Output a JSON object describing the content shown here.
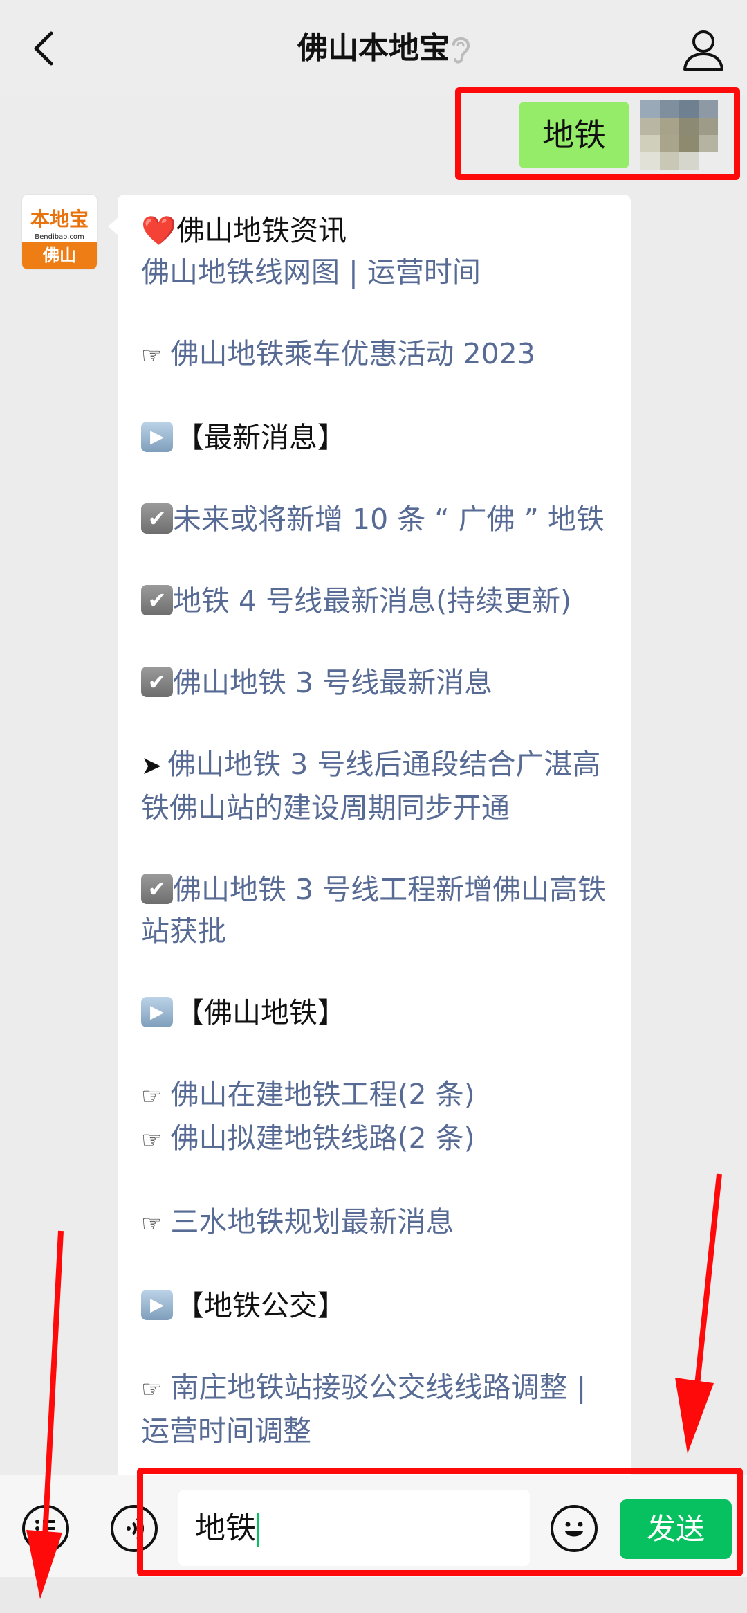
{
  "header": {
    "title": "佛山本地宝"
  },
  "sent_message": "地铁",
  "account_avatar": {
    "logo_text": "本地宝",
    "logo_sub": "Bendibao.com",
    "city": "佛山"
  },
  "message": {
    "lines": [
      {
        "text": "❤️佛山地铁资讯",
        "style": "dark"
      },
      {
        "text": "佛山地铁线网图 | 运营时间",
        "style": "link"
      },
      {
        "text": "佛山地铁乘车优惠活动 2023",
        "style": "link",
        "prefix": "hand",
        "gap_before": true
      },
      {
        "text": "【最新消息】",
        "style": "dark",
        "prefix": "play",
        "gap_before": true
      },
      {
        "text": "未来或将新增 10 条 “ 广佛 ” 地铁",
        "style": "link",
        "prefix": "check",
        "gap_before": true
      },
      {
        "text": "地铁 4 号线最新消息(持续更新)",
        "style": "link",
        "prefix": "check",
        "gap_before": true
      },
      {
        "text": "佛山地铁 3 号线最新消息",
        "style": "link",
        "prefix": "check",
        "gap_before": true
      },
      {
        "text": "佛山地铁 3 号线后通段结合广湛高铁佛山站的建设周期同步开通",
        "style": "link",
        "prefix": "arrow",
        "gap_before": true
      },
      {
        "text": "佛山地铁 3 号线工程新增佛山高铁站获批",
        "style": "link",
        "prefix": "check",
        "gap_before": true
      },
      {
        "text": "【佛山地铁】",
        "style": "dark",
        "prefix": "play",
        "gap_before": true
      },
      {
        "text": "佛山在建地铁工程(2 条)",
        "style": "link",
        "prefix": "hand",
        "gap_before": true
      },
      {
        "text": "佛山拟建地铁线路(2 条)",
        "style": "link",
        "prefix": "hand"
      },
      {
        "text": "三水地铁规划最新消息",
        "style": "link",
        "prefix": "hand",
        "gap_before": true
      },
      {
        "text": "【地铁公交】",
        "style": "dark",
        "prefix": "play",
        "gap_before": true
      },
      {
        "text": "南庄地铁站接驳公交线线路调整 | 运营时间调整",
        "style": "link",
        "prefix": "hand",
        "gap_before": true
      }
    ]
  },
  "input": {
    "value": "地铁"
  },
  "send_button": {
    "label": "发送"
  },
  "icons": {
    "back": "chevron-left-icon",
    "ear": "ear-icon",
    "profile": "person-icon",
    "menu": "menu-list-icon",
    "voice": "voice-icon",
    "emoji": "emoji-icon"
  },
  "colors": {
    "sent_bubble": "#95ec69",
    "send_button": "#07c160",
    "link": "#576b95",
    "highlight": "#ff0a0a"
  }
}
